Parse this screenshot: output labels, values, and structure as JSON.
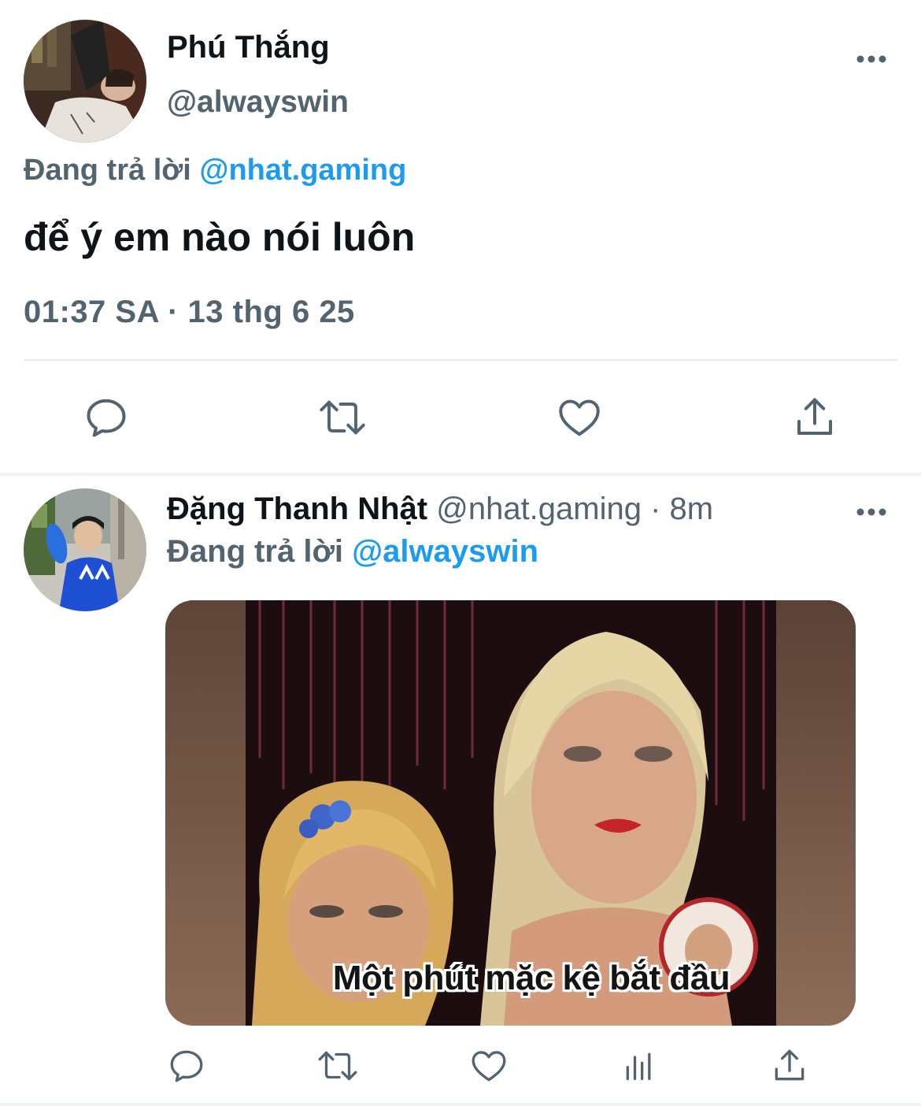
{
  "main_tweet": {
    "author_name": "Phú Thắng",
    "author_handle": "@alwayswin",
    "reply_prefix": "Đang trả lời",
    "reply_to": "@nhat.gaming",
    "text": "để ý em nào nói luôn",
    "timestamp": "01:37 SA · 13 thg 6 25",
    "actions": [
      "reply-icon",
      "retweet-icon",
      "like-icon",
      "share-icon"
    ]
  },
  "reply_tweet": {
    "author_name": "Đặng Thanh Nhật",
    "author_handle": "@nhat.gaming",
    "meta": "· 8m",
    "reply_prefix": "Đang trả lời",
    "reply_to": "@alwayswin",
    "media_caption": "Một phút mặc kệ bắt đầu",
    "actions": [
      "reply-icon",
      "retweet-icon",
      "like-icon",
      "analytics-icon",
      "share-icon"
    ]
  },
  "colors": {
    "text_primary": "#0f1419",
    "text_secondary": "#536471",
    "accent": "#1d9bf0",
    "icon": "#536471"
  }
}
